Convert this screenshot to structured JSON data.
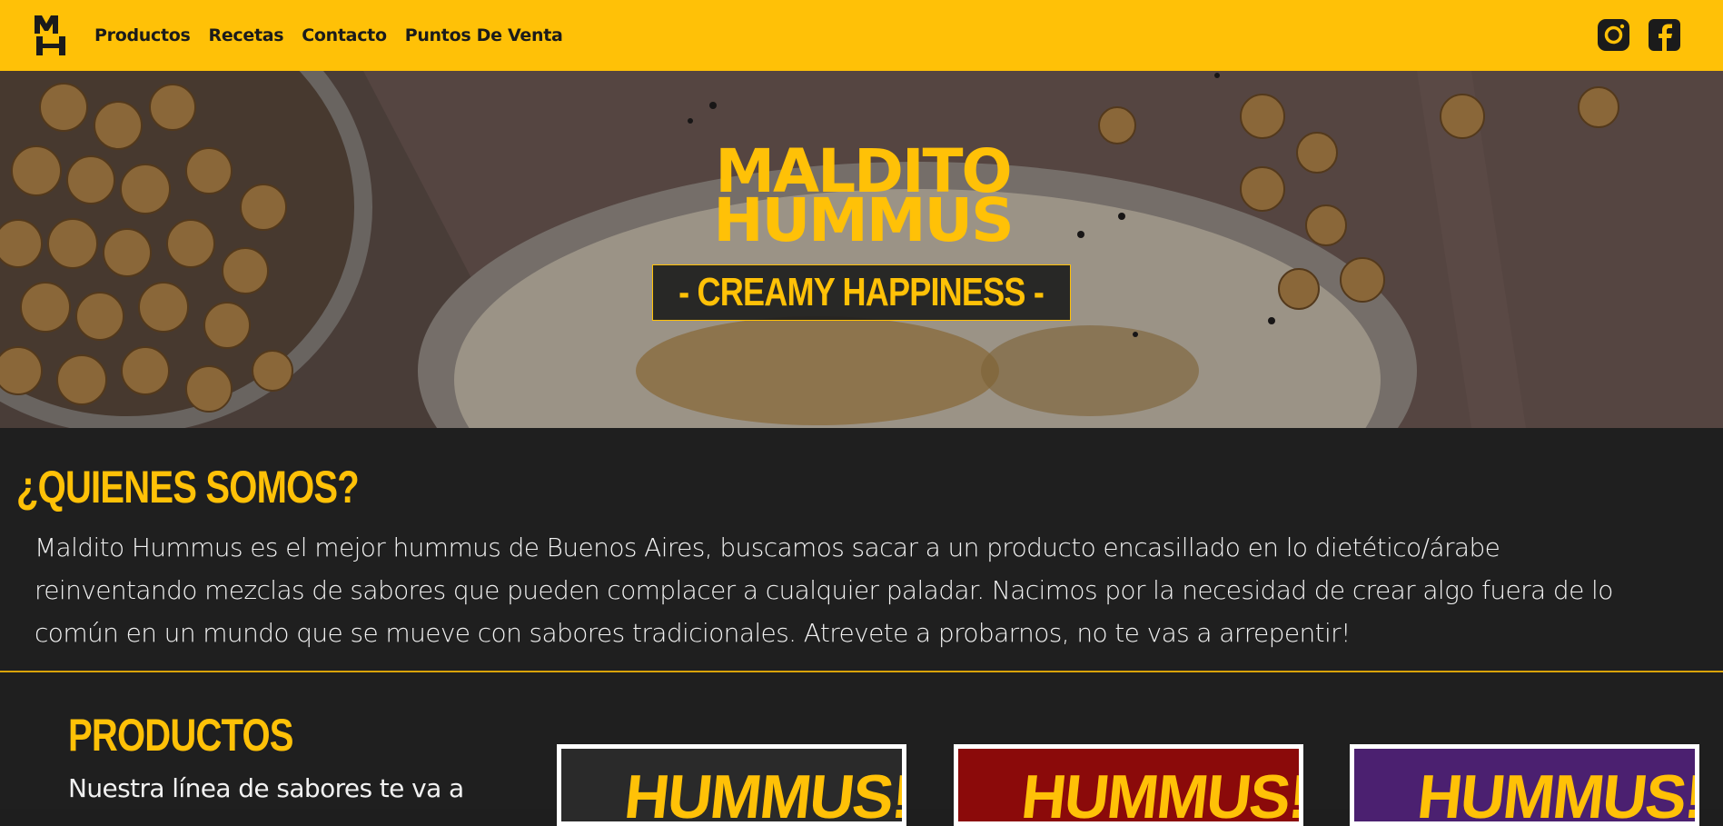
{
  "navbar": {
    "logo_letters": "MH",
    "links": [
      "Productos",
      "Recetas",
      "Contacto",
      "Puntos De Venta"
    ],
    "social": [
      "instagram-icon",
      "facebook-icon"
    ],
    "background_color": "#ffc107"
  },
  "hero": {
    "brand_line1": "MALDITO",
    "brand_line2": "HUMMUS",
    "tagline": "- CREAMY HAPPINESS -",
    "accent_color": "#ffc107"
  },
  "about": {
    "title": "¿QUIENES SOMOS?",
    "text": "Maldito Hummus es el mejor hummus de Buenos Aires, buscamos sacar a un producto encasillado en lo dietético/árabe reinventando mezclas de sabores que pueden complacer a cualquier paladar. Nacimos por la necesidad de crear algo fuera de lo común en un mundo que se mueve con sabores tradicionales. Atrevete a probarnos, no te vas a arrepentir!"
  },
  "products": {
    "title": "PRODUCTOS",
    "description": "Nuestra línea de sabores te va a",
    "cards": [
      {
        "label": "HUMMUS!",
        "color": "#2a2a2a"
      },
      {
        "label": "HUMMUS!",
        "color": "#8b0a0a"
      },
      {
        "label": "HUMMUS!",
        "color": "#4b2070"
      }
    ]
  }
}
